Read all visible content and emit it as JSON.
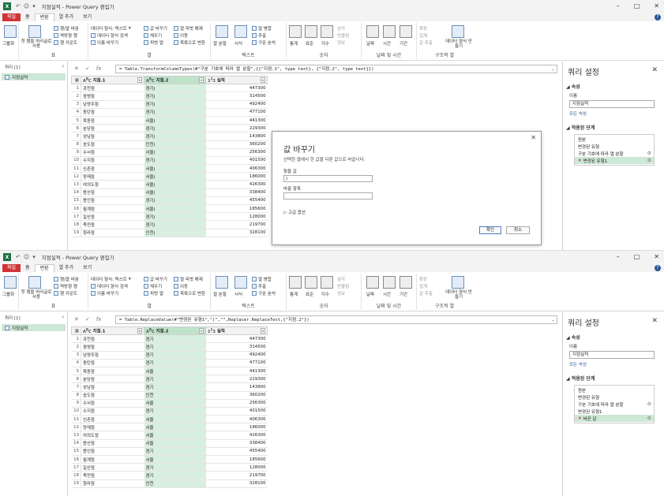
{
  "top": {
    "window_title": "지점실적 - Power Query 편집기",
    "formula": "Table.TransformColumnTypes(#\"구분 기호에 따라 열 분할\",{{\"지점.1\", type text}, {\"지점.2\", type text}})",
    "steps": [
      "원본",
      "변경된 유형",
      "구분 기호에 따라 열 분할",
      "변경된 유형1"
    ],
    "active_step": "변경된 유형1"
  },
  "bottom": {
    "window_title": "지점실적 - Power Query 편집기",
    "formula": "Table.ReplaceValue(#\"변경된 유형1\",\")\",\"\",Replacer.ReplaceText,{\"지점.2\"})",
    "steps": [
      "원본",
      "변경된 유형",
      "구분 기호에 따라 열 분할",
      "변경된 유형1",
      "바꾼 값"
    ],
    "active_step": "바꾼 값"
  },
  "tabs": [
    "파일",
    "홈",
    "변환",
    "열 추가",
    "보기"
  ],
  "active_tab": "변환",
  "ribbon": {
    "group_table": "표",
    "group_any": "열",
    "group_text": "텍스트",
    "group_number": "숫자",
    "group_datetime": "날짜 및 시간",
    "group_struct": "구조적 열",
    "group_by": "그룹화",
    "use_first_row": "첫 행을 머리글로 사용",
    "transpose": "행/열 바꿈",
    "reverse": "역방향 행",
    "count_rows": "행 카운트",
    "data_type": "데이터 형식: 텍스트",
    "detect_type": "데이터 형식 검색",
    "rename": "이름 바꾸기",
    "replace_values": "값 바꾸기",
    "fill": "채우기",
    "pivot": "피벗 열",
    "unpivot": "열 피벗 해제",
    "move": "이동",
    "to_list": "목록으로 변환",
    "split_col": "열 분할",
    "format": "서식",
    "merge_cols": "열 병합",
    "extract": "추출",
    "parse": "구문 분석",
    "stats": "통계",
    "standard": "표준",
    "scientific": "지수",
    "trig": "삼각",
    "rounding": "반올림",
    "info": "정보",
    "date": "날짜",
    "time": "시간",
    "duration": "기간",
    "expand": "확장",
    "aggregate": "집계",
    "extract_values": "값 추출",
    "create_data_type": "데이터 형식 만들기"
  },
  "left_pane": {
    "header": "쿼리 [1]",
    "query": "지점실적"
  },
  "grid": {
    "headers": [
      "지점.1",
      "지점.2",
      "실적"
    ],
    "rows_top": [
      [
        "1",
        "과천점",
        "경기)",
        "447300"
      ],
      [
        "2",
        "광명점",
        "경기)",
        "314500"
      ],
      [
        "3",
        "남양주점",
        "경기)",
        "492400"
      ],
      [
        "4",
        "동탄점",
        "경기)",
        "477100"
      ],
      [
        "5",
        "목동점",
        "서울)",
        "441300"
      ],
      [
        "6",
        "분당점",
        "경기)",
        "229300"
      ],
      [
        "7",
        "성남점",
        "경기)",
        "143800"
      ],
      [
        "8",
        "송도점",
        "인천)",
        "360200"
      ],
      [
        "9",
        "수서점",
        "서울)",
        "256300"
      ],
      [
        "10",
        "수지점",
        "경기)",
        "401500"
      ],
      [
        "11",
        "신촌점",
        "서울)",
        "406300"
      ],
      [
        "12",
        "양재점",
        "서울)",
        "186000"
      ],
      [
        "13",
        "여의도점",
        "서울)",
        "426300"
      ],
      [
        "14",
        "용산점",
        "서울)",
        "338400"
      ],
      [
        "15",
        "용인점",
        "경기)",
        "455400"
      ],
      [
        "16",
        "월계점",
        "서울)",
        "185600"
      ],
      [
        "17",
        "일산점",
        "경기)",
        "128000"
      ],
      [
        "18",
        "죽전점",
        "경기)",
        "219700"
      ],
      [
        "19",
        "청라점",
        "인천)",
        "328100"
      ]
    ],
    "rows_bottom": [
      [
        "1",
        "과천점",
        "경기",
        "447300"
      ],
      [
        "2",
        "광명점",
        "경기",
        "314500"
      ],
      [
        "3",
        "남양주점",
        "경기",
        "492400"
      ],
      [
        "4",
        "동탄점",
        "경기",
        "477100"
      ],
      [
        "5",
        "목동점",
        "서울",
        "441300"
      ],
      [
        "6",
        "분당점",
        "경기",
        "229300"
      ],
      [
        "7",
        "성남점",
        "경기",
        "143800"
      ],
      [
        "8",
        "송도점",
        "인천",
        "360200"
      ],
      [
        "9",
        "수서점",
        "서울",
        "256300"
      ],
      [
        "10",
        "수지점",
        "경기",
        "401500"
      ],
      [
        "11",
        "신촌점",
        "서울",
        "406300"
      ],
      [
        "12",
        "양재점",
        "서울",
        "186000"
      ],
      [
        "13",
        "여의도점",
        "서울",
        "426300"
      ],
      [
        "14",
        "용산점",
        "서울",
        "338400"
      ],
      [
        "15",
        "용인점",
        "경기",
        "455400"
      ],
      [
        "16",
        "월계점",
        "서울",
        "185600"
      ],
      [
        "17",
        "일산점",
        "경기",
        "128000"
      ],
      [
        "18",
        "죽전점",
        "경기",
        "219700"
      ],
      [
        "19",
        "청라점",
        "인천",
        "328100"
      ]
    ]
  },
  "query_settings": {
    "title": "쿼리 설정",
    "props": "속성",
    "name_label": "이름",
    "name_value": "지점실적",
    "all_props": "모든 속성",
    "applied_steps": "적용된 단계"
  },
  "dialog": {
    "title": "값 바꾸기",
    "desc": "선택한 열에서 한 값을 다른 값으로 바꿉니다.",
    "find_label": "찾을 값",
    "find_value": ")",
    "replace_label": "바꿀 항목",
    "replace_value": "",
    "advanced": "고급 옵션",
    "ok": "확인",
    "cancel": "취소"
  }
}
